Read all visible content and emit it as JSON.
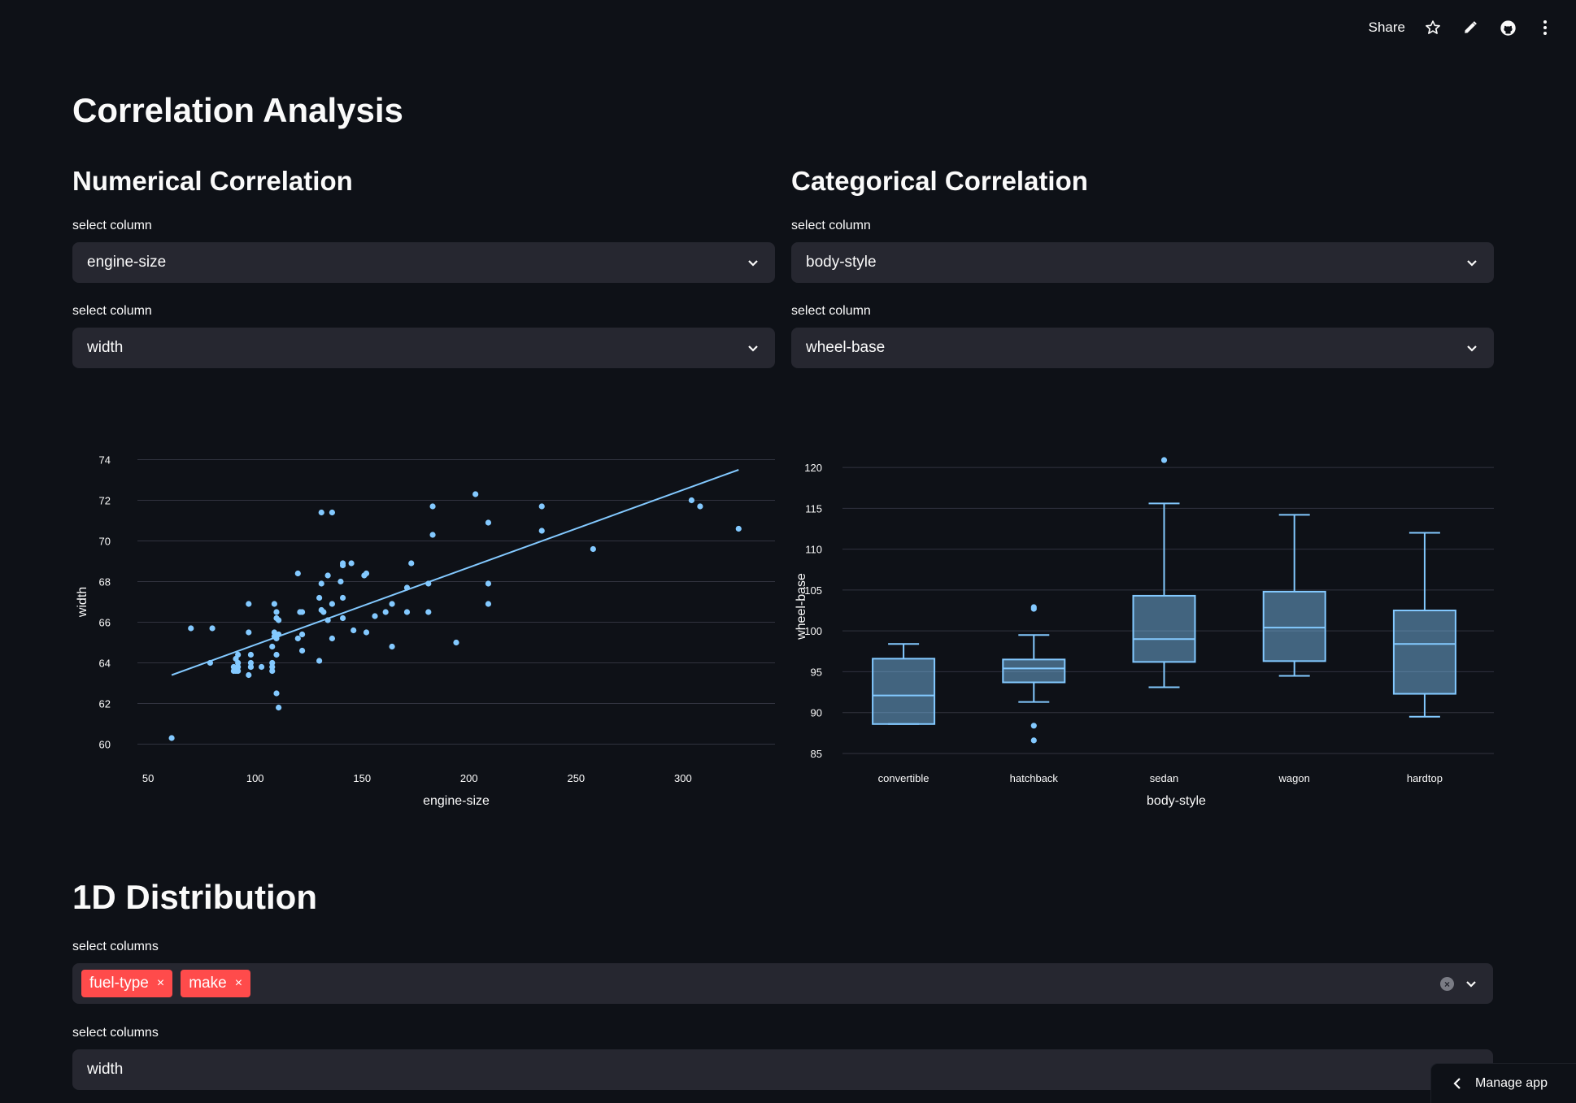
{
  "header": {
    "share_label": "Share",
    "icons": [
      "star-icon",
      "pencil-icon",
      "github-icon",
      "more-vertical-icon"
    ]
  },
  "page_title": "Correlation Analysis",
  "numerical": {
    "heading": "Numerical Correlation",
    "select1": {
      "label": "select column",
      "value": "engine-size"
    },
    "select2": {
      "label": "select column",
      "value": "width"
    }
  },
  "categorical": {
    "heading": "Categorical Correlation",
    "select1": {
      "label": "select column",
      "value": "body-style"
    },
    "select2": {
      "label": "select column",
      "value": "wheel-base"
    }
  },
  "distribution": {
    "heading": "1D Distribution",
    "multiselect": {
      "label": "select columns",
      "tags": [
        "fuel-type",
        "make"
      ],
      "remove_glyph": "×"
    },
    "select2": {
      "label": "select columns",
      "value": "width"
    }
  },
  "manage_app": {
    "label": "Manage app"
  },
  "colors": {
    "accent": "#ff4b4b",
    "marker": "#83c9ff",
    "background": "#0e1117",
    "widget": "#262730"
  },
  "chart_data": [
    {
      "type": "scatter",
      "xlabel": "engine-size",
      "ylabel": "width",
      "xlim": [
        45,
        343
      ],
      "ylim": [
        59.5,
        74.5
      ],
      "xticks": [
        50,
        100,
        150,
        200,
        250,
        300
      ],
      "yticks": [
        60,
        62,
        64,
        66,
        68,
        70,
        72,
        74
      ],
      "grid": "horizontal",
      "points": [
        [
          61,
          60.3
        ],
        [
          70,
          65.7
        ],
        [
          80,
          65.7
        ],
        [
          79,
          64.0
        ],
        [
          90,
          63.8
        ],
        [
          90,
          63.6
        ],
        [
          91,
          63.6
        ],
        [
          91,
          64.2
        ],
        [
          92,
          63.6
        ],
        [
          92,
          64.0
        ],
        [
          92,
          64.4
        ],
        [
          92,
          63.8
        ],
        [
          97,
          65.5
        ],
        [
          97,
          66.9
        ],
        [
          97,
          63.4
        ],
        [
          98,
          63.8
        ],
        [
          98,
          64.0
        ],
        [
          98,
          64.4
        ],
        [
          98,
          63.8
        ],
        [
          103,
          63.8
        ],
        [
          108,
          63.6
        ],
        [
          108,
          63.8
        ],
        [
          108,
          64.0
        ],
        [
          108,
          64.8
        ],
        [
          109,
          65.3
        ],
        [
          109,
          65.5
        ],
        [
          109,
          66.9
        ],
        [
          110,
          66.2
        ],
        [
          110,
          65.2
        ],
        [
          110,
          66.5
        ],
        [
          110,
          64.4
        ],
        [
          110,
          62.5
        ],
        [
          111,
          61.8
        ],
        [
          111,
          65.4
        ],
        [
          111,
          66.1
        ],
        [
          120,
          65.2
        ],
        [
          120,
          68.4
        ],
        [
          121,
          66.5
        ],
        [
          122,
          66.5
        ],
        [
          122,
          64.6
        ],
        [
          122,
          65.4
        ],
        [
          130,
          64.1
        ],
        [
          130,
          67.2
        ],
        [
          131,
          67.9
        ],
        [
          131,
          66.6
        ],
        [
          131,
          71.4
        ],
        [
          132,
          66.5
        ],
        [
          134,
          68.3
        ],
        [
          134,
          66.1
        ],
        [
          136,
          65.2
        ],
        [
          136,
          71.4
        ],
        [
          136,
          66.9
        ],
        [
          140,
          68.0
        ],
        [
          141,
          66.2
        ],
        [
          141,
          67.2
        ],
        [
          141,
          68.8
        ],
        [
          141,
          68.9
        ],
        [
          145,
          68.9
        ],
        [
          146,
          65.6
        ],
        [
          151,
          68.3
        ],
        [
          152,
          65.5
        ],
        [
          152,
          68.4
        ],
        [
          156,
          66.3
        ],
        [
          161,
          66.5
        ],
        [
          164,
          64.8
        ],
        [
          164,
          66.9
        ],
        [
          171,
          67.7
        ],
        [
          171,
          66.5
        ],
        [
          173,
          68.9
        ],
        [
          181,
          66.5
        ],
        [
          181,
          67.9
        ],
        [
          183,
          70.3
        ],
        [
          183,
          71.7
        ],
        [
          194,
          65.0
        ],
        [
          203,
          72.3
        ],
        [
          209,
          70.9
        ],
        [
          209,
          67.9
        ],
        [
          209,
          66.9
        ],
        [
          234,
          71.7
        ],
        [
          234,
          70.5
        ],
        [
          258,
          69.6
        ],
        [
          304,
          72.0
        ],
        [
          308,
          71.7
        ],
        [
          326,
          70.6
        ]
      ],
      "trendline": {
        "x": [
          61,
          326
        ],
        "y": [
          63.4,
          73.5
        ]
      }
    },
    {
      "type": "box",
      "xlabel": "body-style",
      "ylabel": "wheel-base",
      "ylim": [
        84.5,
        121.5
      ],
      "yticks": [
        85,
        90,
        95,
        100,
        105,
        110,
        115,
        120
      ],
      "grid": "horizontal",
      "categories": [
        "convertible",
        "hatchback",
        "sedan",
        "wagon",
        "hardtop"
      ],
      "boxes": [
        {
          "min": 88.6,
          "q1": 88.6,
          "median": 92.1,
          "q3": 96.6,
          "max": 98.4,
          "outliers": []
        },
        {
          "min": 91.3,
          "q1": 93.7,
          "median": 95.4,
          "q3": 96.5,
          "max": 99.5,
          "outliers": [
            102.7,
            102.9,
            86.6,
            88.4
          ]
        },
        {
          "min": 93.1,
          "q1": 96.2,
          "median": 99.0,
          "q3": 104.3,
          "max": 115.6,
          "outliers": [
            120.9
          ]
        },
        {
          "min": 94.5,
          "q1": 96.3,
          "median": 100.4,
          "q3": 104.8,
          "max": 114.2,
          "outliers": []
        },
        {
          "min": 89.5,
          "q1": 92.3,
          "median": 98.4,
          "q3": 102.5,
          "max": 112.0,
          "outliers": []
        }
      ]
    }
  ]
}
